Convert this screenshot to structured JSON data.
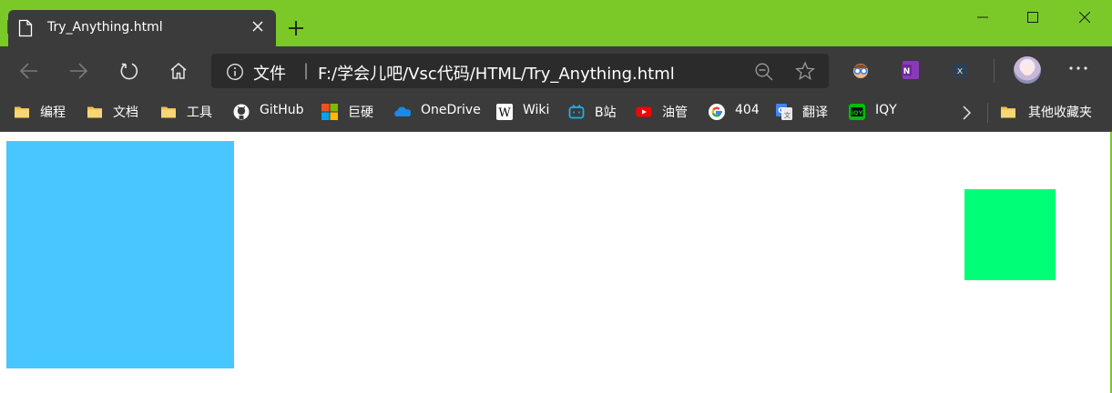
{
  "window": {
    "tab_title": "Try_Anything.html",
    "accent_color": "#7ac928"
  },
  "toolbar": {
    "scheme_label": "文件",
    "url": "F:/学会儿吧/Vsc代码/HTML/Try_Anything.html"
  },
  "bookmarks": [
    {
      "label": "编程",
      "icon": "folder-icon"
    },
    {
      "label": "文档",
      "icon": "folder-icon"
    },
    {
      "label": "工具",
      "icon": "folder-icon"
    },
    {
      "label": "GitHub",
      "icon": "github-icon"
    },
    {
      "label": "巨硬",
      "icon": "microsoft-icon"
    },
    {
      "label": "OneDrive",
      "icon": "onedrive-icon"
    },
    {
      "label": "Wiki",
      "icon": "wikipedia-icon"
    },
    {
      "label": "B站",
      "icon": "bilibili-icon"
    },
    {
      "label": "油管",
      "icon": "youtube-icon"
    },
    {
      "label": "404",
      "icon": "google-icon"
    },
    {
      "label": "翻译",
      "icon": "translate-icon"
    },
    {
      "label": "IQY",
      "icon": "iqiyi-icon"
    }
  ],
  "other_bookmarks": {
    "label": "其他收藏夹",
    "icon": "folder-icon"
  },
  "content": {
    "blue_box_color": "#48c6ff",
    "green_box_color": "#00ff77"
  }
}
